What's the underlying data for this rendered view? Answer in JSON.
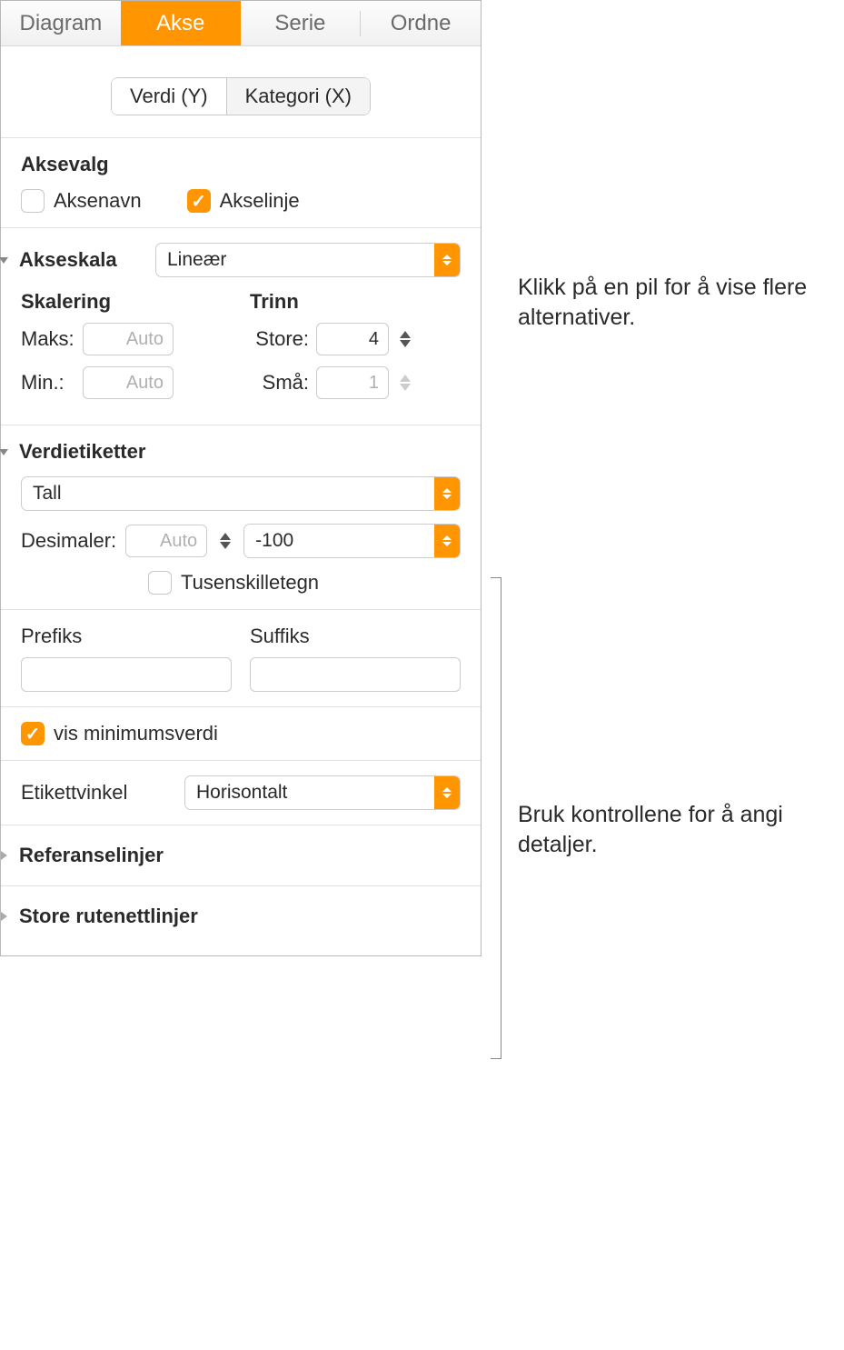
{
  "tabs": {
    "diagram": "Diagram",
    "akse": "Akse",
    "serie": "Serie",
    "ordne": "Ordne"
  },
  "segments": {
    "value_y": "Verdi (Y)",
    "category_x": "Kategori (X)"
  },
  "axis_options": {
    "title": "Aksevalg",
    "axis_name": "Aksenavn",
    "axis_line": "Akselinje"
  },
  "axis_scale": {
    "title": "Akseskala",
    "type": "Lineær",
    "scaling_title": "Skalering",
    "steps_title": "Trinn",
    "max": "Maks:",
    "min": "Min.:",
    "big": "Store:",
    "small": "Små:",
    "max_val": "",
    "max_ph": "Auto",
    "min_val": "",
    "min_ph": "Auto",
    "big_val": "4",
    "small_val": "1"
  },
  "value_labels": {
    "title": "Verdietiketter",
    "type": "Tall",
    "decimals_label": "Desimaler:",
    "decimals_val": "",
    "decimals_ph": "Auto",
    "neg_format": "-100",
    "thousands": "Tusenskilletegn"
  },
  "affix": {
    "prefix": "Prefiks",
    "suffix": "Suffiks"
  },
  "show_min": "vis minimumsverdi",
  "label_angle": {
    "label": "Etikettvinkel",
    "value": "Horisontalt"
  },
  "collapsed": {
    "reference_lines": "Referanselinjer",
    "gridlines": "Store rutenettlinjer"
  },
  "callouts": {
    "top": "Klikk på en pil for å vise flere alternativer.",
    "mid": "Bruk kontrollene for å angi detaljer."
  }
}
